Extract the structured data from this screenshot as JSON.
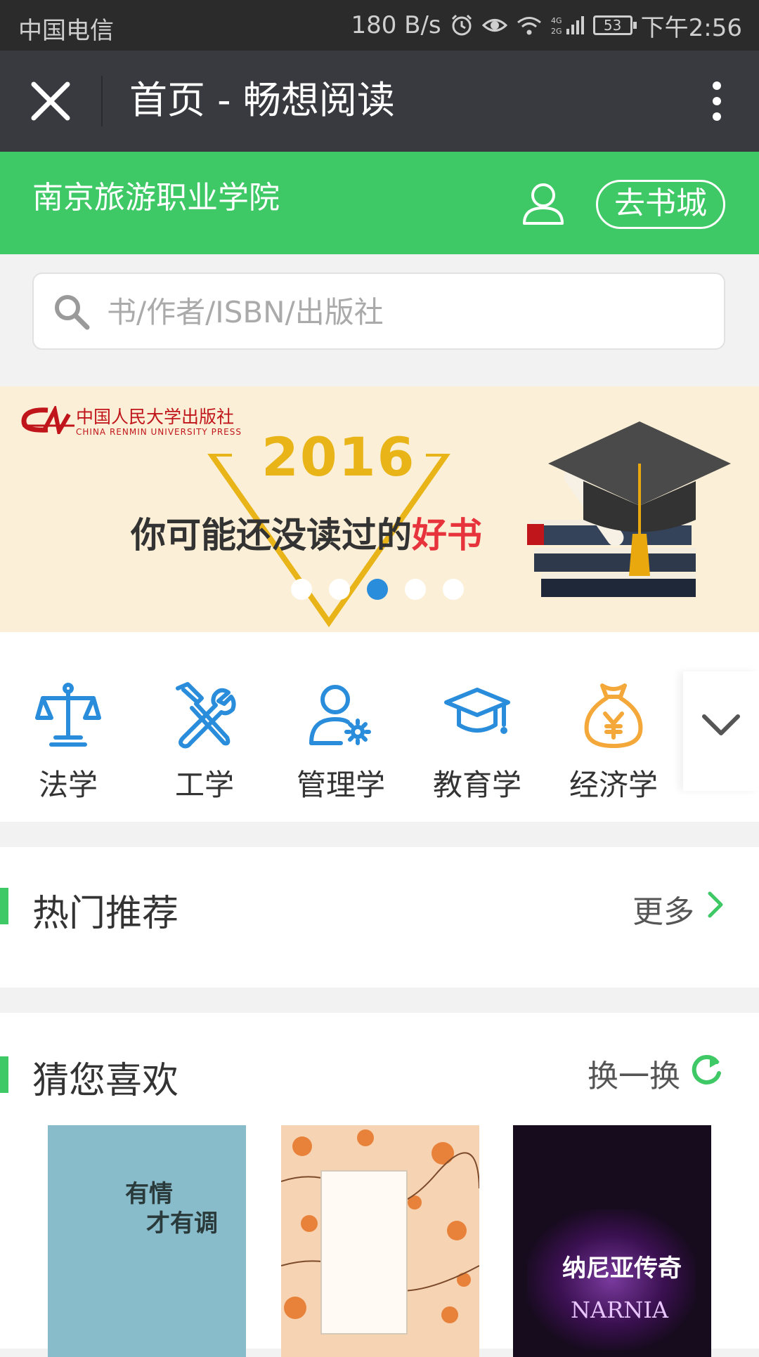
{
  "status_bar": {
    "carrier": "中国电信",
    "speed": "180 B/s",
    "network": "4G 2G",
    "battery": "53",
    "time": "下午2:56"
  },
  "title_bar": {
    "title": "首页 - 畅想阅读",
    "close_icon": "close-icon",
    "more_icon": "more-vertical-icon"
  },
  "header": {
    "school": "南京旅游职业学院",
    "bookstore_button": "去书城",
    "user_icon": "user-icon"
  },
  "search": {
    "placeholder": "书/作者/ISBN/出版社"
  },
  "banner": {
    "publisher_cn": "中国人民大学出版社",
    "publisher_en": "CHINA RENMIN UNIVERSITY PRESS",
    "year": "2016",
    "slogan": "你可能还没读过的",
    "slogan_highlight": "好书",
    "dots_total": 5,
    "active_dot": 3,
    "colors": {
      "accent": "#e8b418",
      "highlight": "#e7343c",
      "dot_active": "#2a8ddb"
    }
  },
  "categories": [
    {
      "label": "法学",
      "icon": "scales-icon",
      "color": "#2a8ddb"
    },
    {
      "label": "工学",
      "icon": "tools-icon",
      "color": "#2a8ddb"
    },
    {
      "label": "管理学",
      "icon": "user-gear-icon",
      "color": "#2a8ddb"
    },
    {
      "label": "教育学",
      "icon": "graduation-cap-icon",
      "color": "#2a8ddb"
    },
    {
      "label": "经济学",
      "icon": "money-bag-icon",
      "color": "#f4a83a"
    }
  ],
  "sections": {
    "hot": {
      "title": "热门推荐",
      "action": "更多"
    },
    "guess": {
      "title": "猜您喜欢",
      "action": "换一换"
    }
  },
  "books": [
    {
      "title_line1": "有情",
      "title_line2": "才有调"
    },
    {
      "title_line1": "",
      "title_line2": ""
    },
    {
      "title_line1": "纳尼亚传奇",
      "title_line2": "NARNIA"
    }
  ],
  "theme": {
    "green": "#3ec966",
    "titlebar": "#393a3f"
  }
}
